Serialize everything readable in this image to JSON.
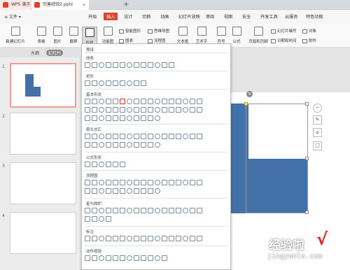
{
  "titlebar": {
    "app_tab": "WPS 演示",
    "doc_tab": "完善经验2.pptx",
    "close": "×",
    "new_tab": "+"
  },
  "menu": {
    "file": "≡ 文件 ▾",
    "items": [
      "开始",
      "插入",
      "设计",
      "切换",
      "动画",
      "幻灯片放映",
      "审阅",
      "视图",
      "安全",
      "开发工具",
      "云服务",
      "特色功能"
    ],
    "active_index": 1
  },
  "ribbon": {
    "new_slide": "新建幻灯片",
    "table": "表格",
    "picture": "图片",
    "screenshot": "截屏",
    "shapes": "形状",
    "function_chart": "功能图",
    "smart_shape": "智能图形",
    "chart": "图表",
    "mindmap": "思维导图",
    "flowchart": "流程图",
    "textbox": "文本框",
    "wordart": "艺术字",
    "symbol": "符号",
    "formula": "公式",
    "header_footer": "页眉和页脚",
    "slide_number": "幻灯片编号",
    "datetime": "日期和时间",
    "object": "对象",
    "attachment": "附件"
  },
  "leftpane": {
    "tab_outline": "大纲",
    "tab_slides": "幻灯片",
    "thumb_numbers": [
      "1",
      "2",
      "3",
      "4"
    ]
  },
  "dropdown": {
    "preset": "预设",
    "sections": [
      "线条",
      "矩形",
      "基本形状",
      "箭头总汇",
      "公式形状",
      "流程图",
      "星与旗帜",
      "标注",
      "动作按钮"
    ]
  },
  "floating_tools": {
    "minus": "−",
    "pencil": "✎",
    "shape": "⌂",
    "square": "□"
  },
  "watermark": {
    "text": "经验啦",
    "url": "jingyanla.com",
    "check": "√"
  },
  "colors": {
    "accent": "#d9462e",
    "shape_fill": "#4470a8"
  }
}
